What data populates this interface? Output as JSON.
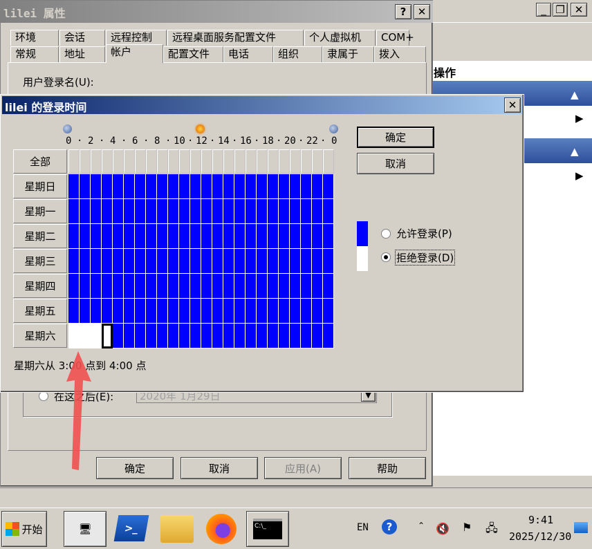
{
  "bg": {
    "ops": "操作",
    "right_btn1": "",
    "items": [
      "",
      ""
    ]
  },
  "props": {
    "title": "lilei 属性",
    "tabs_row1": [
      "环境",
      "会话",
      "远程控制",
      "远程桌面服务配置文件",
      "个人虚拟机",
      "COM+"
    ],
    "tabs_row2": [
      "常规",
      "地址",
      "帐户",
      "配置文件",
      "电话",
      "组织",
      "隶属于",
      "拨入"
    ],
    "logon_label": "用户登录名(U):",
    "expire_label": "在这之后(E):",
    "expire_date": "2020年 1月29日",
    "ok": "确定",
    "cancel": "取消",
    "apply": "应用(A)",
    "help": "帮助"
  },
  "dialog": {
    "title": "lilei 的登录时间",
    "ok": "确定",
    "cancel": "取消",
    "all": "全部",
    "days": [
      "星期日",
      "星期一",
      "星期二",
      "星期三",
      "星期四",
      "星期五",
      "星期六"
    ],
    "ticks": [
      "0",
      "·",
      "2",
      "·",
      "4",
      "·",
      "6",
      "·",
      "8",
      "·",
      "10",
      "·",
      "12",
      "·",
      "14",
      "·",
      "16",
      "·",
      "18",
      "·",
      "20",
      "·",
      "22",
      "·",
      "0"
    ],
    "allow": "允许登录(P)",
    "deny": "拒绝登录(D)",
    "status": "星期六从 3:00 点到 4:00 点",
    "legend_allow_color": "#0000ff",
    "legend_deny_color": "#ffffff"
  },
  "grid": {
    "denied_saturday_hours": [
      0,
      1,
      2,
      3
    ]
  },
  "taskbar": {
    "start": "开始",
    "lang": "EN",
    "time": "9:41",
    "date": "2025/12/30"
  }
}
